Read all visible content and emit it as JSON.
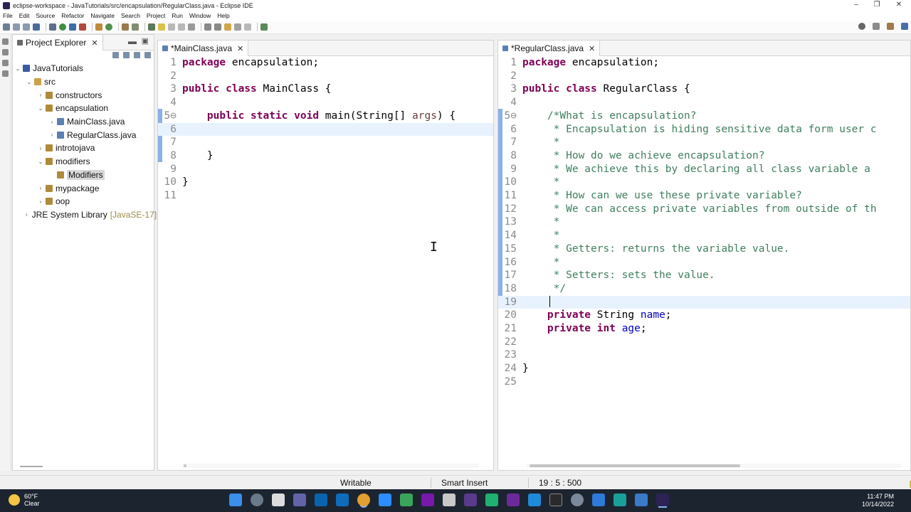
{
  "window": {
    "title": "eclipse-workspace - JavaTutorials/src/encapsulation/RegularClass.java - Eclipse IDE",
    "minimize": "–",
    "maximize": "❐",
    "close": "✕"
  },
  "menu": [
    "File",
    "Edit",
    "Source",
    "Refactor",
    "Navigate",
    "Search",
    "Project",
    "Run",
    "Window",
    "Help"
  ],
  "explorer": {
    "title": "Project Explorer",
    "close": "✕",
    "items": [
      {
        "label": "JavaTutorials",
        "arrow": "⌄",
        "type": "proj"
      },
      {
        "label": "src",
        "arrow": "⌄",
        "type": "folder"
      },
      {
        "label": "constructors",
        "arrow": "›",
        "type": "pkg"
      },
      {
        "label": "encapsulation",
        "arrow": "⌄",
        "type": "pkg"
      },
      {
        "label": "MainClass.java",
        "arrow": "›",
        "type": "java"
      },
      {
        "label": "RegularClass.java",
        "arrow": "›",
        "type": "java"
      },
      {
        "label": "introtojava",
        "arrow": "›",
        "type": "pkg"
      },
      {
        "label": "modifiers",
        "arrow": "⌄",
        "type": "pkg"
      },
      {
        "label": "Modifiers",
        "arrow": "",
        "type": "pkg"
      },
      {
        "label": "mypackage",
        "arrow": "›",
        "type": "pkg"
      },
      {
        "label": "oop",
        "arrow": "›",
        "type": "pkg"
      },
      {
        "label": "JRE System Library",
        "arrow": "›",
        "type": "lib",
        "suffix": "[JavaSE-17]"
      }
    ]
  },
  "editors": {
    "left": {
      "tab": "*MainClass.java",
      "close": "✕",
      "lines": [
        {
          "n": "1",
          "html": "<span class=\"kw\">package</span> encapsulation;"
        },
        {
          "n": "2",
          "html": ""
        },
        {
          "n": "3",
          "html": "<span class=\"kw\">public class</span> MainClass {"
        },
        {
          "n": "4",
          "html": ""
        },
        {
          "n": "5⊖",
          "html": "    <span class=\"kw\">public static void</span> main(String[] <span class=\"param\">args</span>) {"
        },
        {
          "n": "6",
          "html": "",
          "current": true
        },
        {
          "n": "7",
          "html": ""
        },
        {
          "n": "8",
          "html": "    }"
        },
        {
          "n": "9",
          "html": ""
        },
        {
          "n": "10",
          "html": "}"
        },
        {
          "n": "11",
          "html": ""
        }
      ]
    },
    "right": {
      "tab": "*RegularClass.java",
      "close": "✕",
      "lines": [
        {
          "n": "1",
          "html": "<span class=\"kw\">package</span> encapsulation;"
        },
        {
          "n": "2",
          "html": ""
        },
        {
          "n": "3",
          "html": "<span class=\"kw\">public class</span> RegularClass {"
        },
        {
          "n": "4",
          "html": ""
        },
        {
          "n": "5⊖",
          "html": "    <span class=\"cm\">/*What is encapsulation?</span>"
        },
        {
          "n": "6",
          "html": "<span class=\"cm\">     * Encapsulation is hiding sensitive data form user c</span>"
        },
        {
          "n": "7",
          "html": "<span class=\"cm\">     *</span>"
        },
        {
          "n": "8",
          "html": "<span class=\"cm\">     * How do we achieve encapsulation?</span>"
        },
        {
          "n": "9",
          "html": "<span class=\"cm\">     * We achieve this by declaring all class variable a</span>"
        },
        {
          "n": "10",
          "html": "<span class=\"cm\">     *</span>"
        },
        {
          "n": "11",
          "html": "<span class=\"cm\">     * How can we use these private variable?</span>"
        },
        {
          "n": "12",
          "html": "<span class=\"cm\">     * We can access private variables from outside of th</span>"
        },
        {
          "n": "13",
          "html": "<span class=\"cm\">     *</span>"
        },
        {
          "n": "14",
          "html": "<span class=\"cm\">     *</span>"
        },
        {
          "n": "15",
          "html": "<span class=\"cm\">     * Getters: returns the variable value.</span>"
        },
        {
          "n": "16",
          "html": "<span class=\"cm\">     *</span>"
        },
        {
          "n": "17",
          "html": "<span class=\"cm\">     * Setters: sets the value.</span>"
        },
        {
          "n": "18",
          "html": "<span class=\"cm\">     */</span>"
        },
        {
          "n": "19",
          "html": "",
          "current": true
        },
        {
          "n": "20",
          "html": "    <span class=\"kw\">private</span> String <span class=\"fld\">name</span>;"
        },
        {
          "n": "21",
          "html": "    <span class=\"kw\">private int</span> <span class=\"fld\">age</span>;"
        },
        {
          "n": "22",
          "html": ""
        },
        {
          "n": "23",
          "html": ""
        },
        {
          "n": "24",
          "html": "}"
        },
        {
          "n": "25",
          "html": ""
        }
      ]
    }
  },
  "status": {
    "writable": "Writable",
    "insert_mode": "Smart Insert",
    "position": "19 : 5 : 500"
  },
  "taskbar": {
    "weather_temp": "60°F",
    "weather_desc": "Clear",
    "time": "11:47 PM",
    "date": "10/14/2022"
  }
}
